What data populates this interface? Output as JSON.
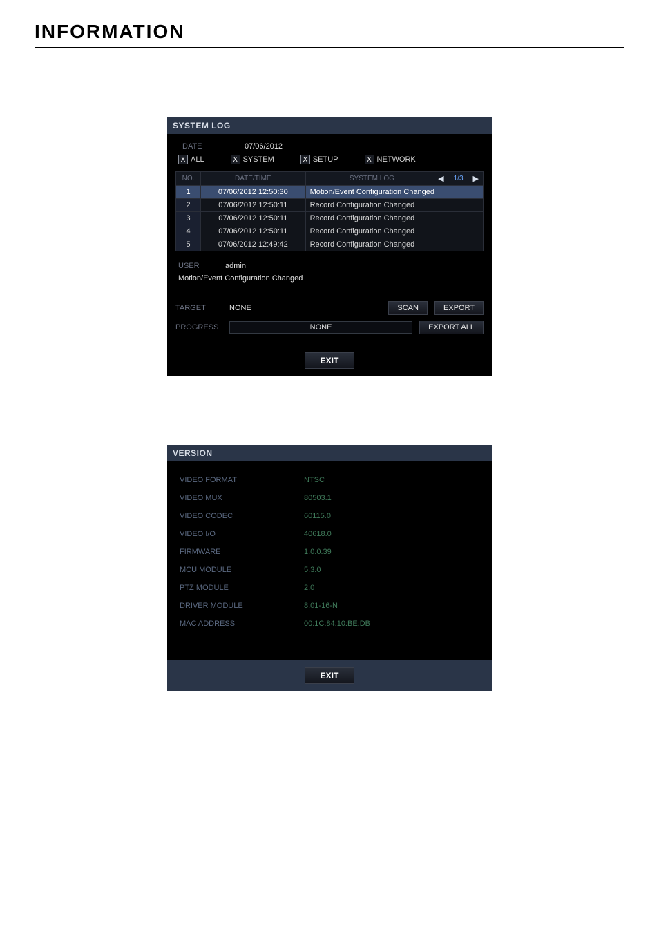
{
  "page": {
    "heading": "INFORMATION"
  },
  "syslog": {
    "title": "SYSTEM LOG",
    "date_label": "DATE",
    "date_value": "07/06/2012",
    "filters": {
      "all": "ALL",
      "system": "SYSTEM",
      "setup": "SETUP",
      "network": "NETWORK",
      "mark": "X"
    },
    "headers": {
      "no": "NO.",
      "datetime": "DATE/TIME",
      "log": "SYSTEM LOG"
    },
    "pager": {
      "prev": "◀",
      "page": "1/3",
      "next": "▶"
    },
    "rows": [
      {
        "no": "1",
        "dt": "07/06/2012  12:50:30",
        "msg": "Motion/Event Configuration Changed",
        "hl": true
      },
      {
        "no": "2",
        "dt": "07/06/2012  12:50:11",
        "msg": "Record Configuration Changed",
        "hl": false
      },
      {
        "no": "3",
        "dt": "07/06/2012  12:50:11",
        "msg": "Record Configuration Changed",
        "hl": false
      },
      {
        "no": "4",
        "dt": "07/06/2012  12:50:11",
        "msg": "Record Configuration Changed",
        "hl": false
      },
      {
        "no": "5",
        "dt": "07/06/2012  12:49:42",
        "msg": "Record Configuration Changed",
        "hl": false
      }
    ],
    "meta": {
      "user_label": "USER",
      "user_value": "admin",
      "detail": "Motion/Event Configuration Changed"
    },
    "target_label": "TARGET",
    "target_value": "NONE",
    "progress_label": "PROGRESS",
    "progress_value": "NONE",
    "buttons": {
      "scan": "SCAN",
      "export": "EXPORT",
      "export_all": "EXPORT ALL",
      "exit": "EXIT"
    }
  },
  "version": {
    "title": "VERSION",
    "items": [
      {
        "k": "VIDEO FORMAT",
        "v": "NTSC"
      },
      {
        "k": "VIDEO MUX",
        "v": "80503.1"
      },
      {
        "k": "VIDEO CODEC",
        "v": "60115.0"
      },
      {
        "k": "VIDEO I/O",
        "v": "40618.0"
      },
      {
        "k": "FIRMWARE",
        "v": "1.0.0.39"
      },
      {
        "k": "MCU MODULE",
        "v": "5.3.0"
      },
      {
        "k": "PTZ MODULE",
        "v": "2.0"
      },
      {
        "k": "DRIVER MODULE",
        "v": "8.01-16-N"
      },
      {
        "k": "MAC ADDRESS",
        "v": "00:1C:84:10:BE:DB"
      }
    ],
    "exit": "EXIT"
  }
}
